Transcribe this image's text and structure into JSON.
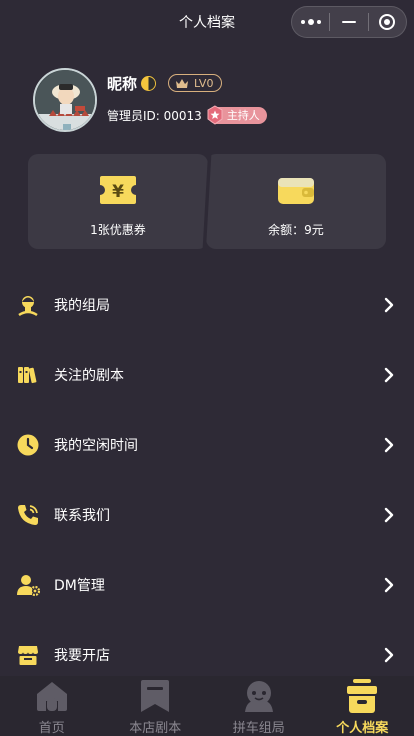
{
  "header": {
    "title": "个人档案"
  },
  "profile": {
    "nickname": "昵称",
    "level": "LV0",
    "admin_id": "管理员ID: 00013",
    "role_badge": "主持人"
  },
  "cards": {
    "coupon_label": "1张优惠券",
    "balance_label": "余额：9元",
    "coupon_symbol": "¥"
  },
  "menu": [
    {
      "label": "我的组局",
      "icon": "game-group-icon"
    },
    {
      "label": "关注的剧本",
      "icon": "books-icon"
    },
    {
      "label": "我的空闲时间",
      "icon": "clock-icon"
    },
    {
      "label": "联系我们",
      "icon": "phone-icon"
    },
    {
      "label": "DM管理",
      "icon": "user-gear-icon"
    },
    {
      "label": "我要开店",
      "icon": "store-icon"
    }
  ],
  "tabs": [
    {
      "label": "首页",
      "icon": "home-icon",
      "active": false
    },
    {
      "label": "本店剧本",
      "icon": "bookmark-icon",
      "active": false
    },
    {
      "label": "拼车组局",
      "icon": "ghost-icon",
      "active": false
    },
    {
      "label": "个人档案",
      "icon": "archive-box-icon",
      "active": true
    }
  ],
  "colors": {
    "background": "#2e2a36",
    "card": "#3c3944",
    "accent_yellow": "#f7d95c",
    "badge_pink": "#e8949c",
    "level_gold": "#d8b07e"
  }
}
